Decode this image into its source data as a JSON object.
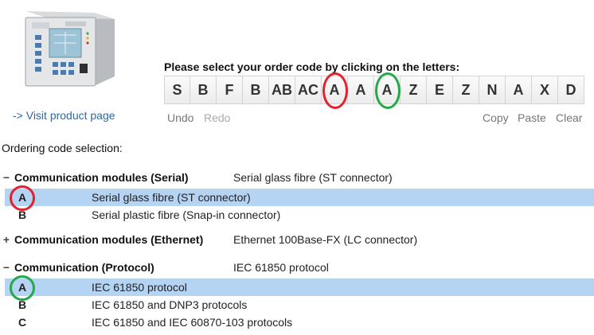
{
  "product": {
    "image_icon": "protection-relay-device-image",
    "visit_link": "-> Visit product page"
  },
  "order": {
    "prompt": "Please select your order code by clicking on the letters:",
    "letters": [
      {
        "text": "S",
        "ring": ""
      },
      {
        "text": "B",
        "ring": ""
      },
      {
        "text": "F",
        "ring": ""
      },
      {
        "text": "B",
        "ring": ""
      },
      {
        "text": "AB",
        "ring": ""
      },
      {
        "text": "AC",
        "ring": ""
      },
      {
        "text": "A",
        "ring": "red"
      },
      {
        "text": "A",
        "ring": ""
      },
      {
        "text": "A",
        "ring": "green"
      },
      {
        "text": "Z",
        "ring": ""
      },
      {
        "text": "E",
        "ring": ""
      },
      {
        "text": "Z",
        "ring": ""
      },
      {
        "text": "N",
        "ring": ""
      },
      {
        "text": "A",
        "ring": ""
      },
      {
        "text": "X",
        "ring": ""
      },
      {
        "text": "D",
        "ring": ""
      }
    ],
    "actions": {
      "undo": "Undo",
      "redo": "Redo",
      "copy": "Copy",
      "paste": "Paste",
      "clear": "Clear"
    }
  },
  "selection": {
    "title": "Ordering code selection:",
    "groups": [
      {
        "toggle": "−",
        "name": "Communication modules (Serial)",
        "value": "Serial glass fibre (ST connector)",
        "options": [
          {
            "code": "A",
            "label": "Serial glass fibre (ST connector)",
            "selected": true,
            "ring": "red"
          },
          {
            "code": "B",
            "label": "Serial plastic fibre (Snap-in connector)",
            "selected": false,
            "ring": ""
          }
        ]
      },
      {
        "toggle": "+",
        "name": "Communication modules (Ethernet)",
        "value": "Ethernet 100Base-FX (LC connector)",
        "options": []
      },
      {
        "toggle": "−",
        "name": "Communication (Protocol)",
        "value": "IEC 61850 protocol",
        "options": [
          {
            "code": "A",
            "label": "IEC 61850 protocol",
            "selected": true,
            "ring": "green"
          },
          {
            "code": "B",
            "label": "IEC 61850 and DNP3 protocols",
            "selected": false,
            "ring": ""
          },
          {
            "code": "C",
            "label": "IEC 61850 and IEC 60870-103 protocols",
            "selected": false,
            "ring": ""
          }
        ]
      }
    ]
  },
  "colors": {
    "red": "#e0232e",
    "green": "#23a84a",
    "selected_row": "#b5d3f3",
    "link": "#2a6aa8"
  }
}
